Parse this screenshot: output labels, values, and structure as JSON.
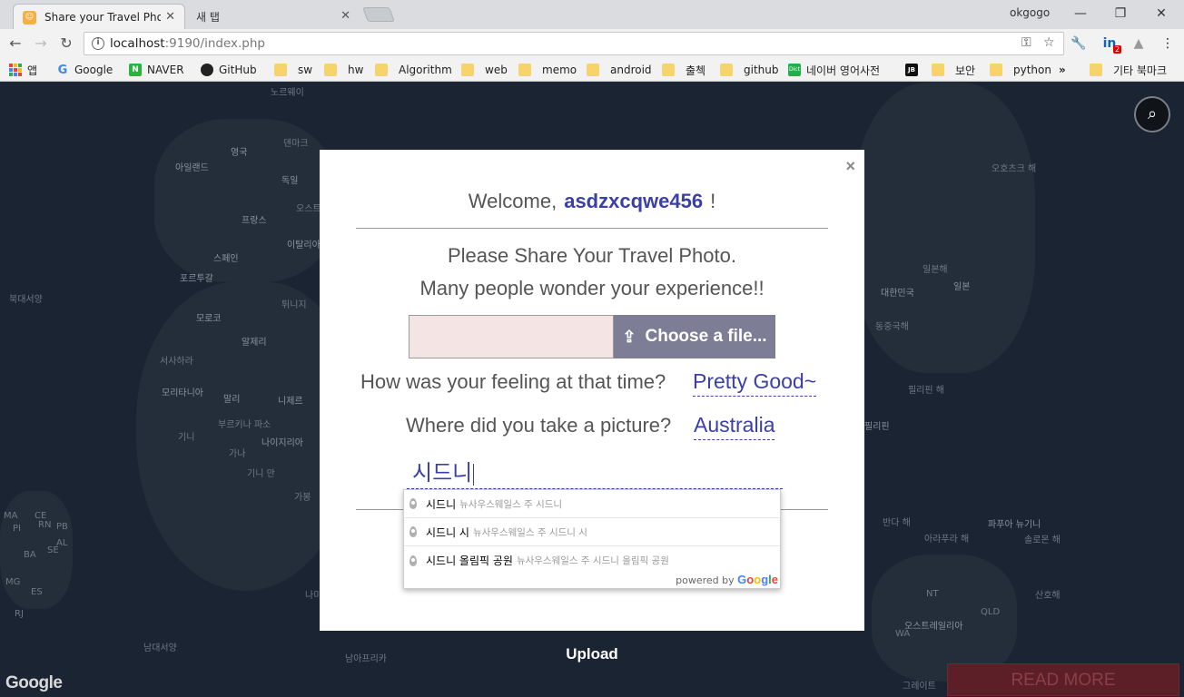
{
  "browser": {
    "tabs": [
      {
        "label": "Share your Travel Photo",
        "active": true
      },
      {
        "label": "새 탭",
        "active": false
      }
    ],
    "profile": "okgogo",
    "url_host": "localhost",
    "url_rest": ":9190/index.php",
    "extension_badge": "2"
  },
  "bookmarks": [
    {
      "label": "앱",
      "icon": "apps-icon"
    },
    {
      "label": "Google",
      "icon": "google-icon"
    },
    {
      "label": "NAVER",
      "icon": "naver-icon"
    },
    {
      "label": "GitHub",
      "icon": "github-icon"
    },
    {
      "label": "sw",
      "icon": "folder-icon"
    },
    {
      "label": "hw",
      "icon": "folder-icon"
    },
    {
      "label": "Algorithm",
      "icon": "folder-icon"
    },
    {
      "label": "web",
      "icon": "folder-icon"
    },
    {
      "label": "memo",
      "icon": "folder-icon"
    },
    {
      "label": "android",
      "icon": "folder-icon"
    },
    {
      "label": "출첵",
      "icon": "folder-icon"
    },
    {
      "label": "github",
      "icon": "folder-icon"
    },
    {
      "label": "네이버 영어사전",
      "icon": "dict-icon"
    },
    {
      "label": "",
      "icon": "jb-icon"
    },
    {
      "label": "보안",
      "icon": "folder-icon"
    },
    {
      "label": "python",
      "icon": "folder-icon"
    },
    {
      "label": "»",
      "icon": ""
    },
    {
      "label": "기타 북마크",
      "icon": "folder-icon"
    }
  ],
  "map": {
    "labels": [
      "노르웨이",
      "영국",
      "아일랜드",
      "덴마크",
      "독일",
      "오스트",
      "프랑스",
      "이탈리아",
      "스페인",
      "포르투갈",
      "북대서양",
      "튀니지",
      "모로코",
      "알제리",
      "서사하라",
      "모리타니아",
      "말리",
      "니제르",
      "부르키나 파소",
      "나이지리아",
      "기니",
      "가나",
      "기니 만",
      "가봉",
      "나미",
      "남대서양",
      "남아프리카",
      "오호츠크 해",
      "일본해",
      "대한민국",
      "일본",
      "동중국해",
      "필리핀 해",
      "필리핀",
      "반다 해",
      "파푸아 뉴기니",
      "아라푸라 해",
      "솔로몬 해",
      "산호해",
      "NT",
      "QLD",
      "WA",
      "오스트레일리아",
      "그레이트",
      "MA",
      "CE",
      "RN",
      "PB",
      "PI",
      "AL",
      "SE",
      "BA",
      "MG",
      "ES",
      "RJ"
    ],
    "attribution": "Google"
  },
  "modal": {
    "close": "×",
    "welcome_prefix": "Welcome,",
    "username": "asdzxcqwe456",
    "welcome_suffix": "!",
    "line1": "Please Share Your Travel Photo.",
    "line2": "Many people wonder your experience!!",
    "file_button": "Choose a file...",
    "q_feeling": "How was your feeling at that time?",
    "a_feeling": "Pretty Good~",
    "q_place": "Where did you take a picture?",
    "a_place": "Australia",
    "place_input": "시드니"
  },
  "autocomplete": {
    "items": [
      {
        "main": "시드니",
        "secondary": "뉴사우스웨일스 주 시드니"
      },
      {
        "main": "시드니 시",
        "secondary": "뉴사우스웨일스 주 시드니 시"
      },
      {
        "main": "시드니 올림픽 공원",
        "secondary": "뉴사우스웨일스 주 시드니 올림픽 공원"
      }
    ],
    "powered_by": "powered by",
    "google": "Google"
  },
  "upload_label": "Upload",
  "read_more_label": "READ MORE",
  "colors": {
    "accent": "#3b3fa8",
    "file_button_bg": "#7d7d95",
    "read_more_bg": "#5d1f27",
    "map_bg": "#1a2433"
  }
}
